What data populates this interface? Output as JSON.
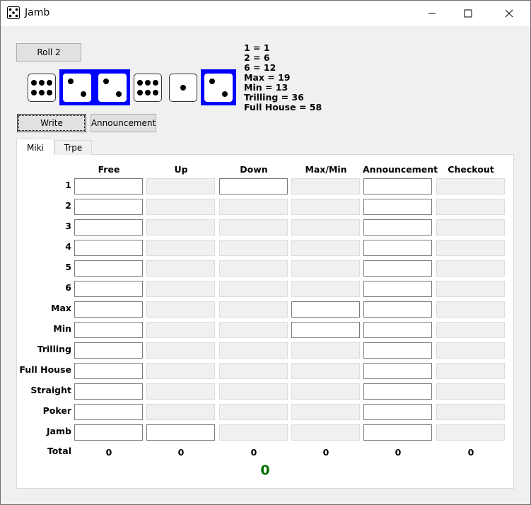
{
  "window": {
    "title": "Jamb"
  },
  "controls": {
    "roll_label": "Roll 2",
    "write_label": "Write",
    "announcement_label": "Announcement"
  },
  "dice": [
    {
      "value": 6,
      "selected": false
    },
    {
      "value": 2,
      "selected": true
    },
    {
      "value": 2,
      "selected": true
    },
    {
      "value": 6,
      "selected": false
    },
    {
      "value": 1,
      "selected": false
    },
    {
      "value": 2,
      "selected": true
    }
  ],
  "info_lines": [
    "1 = 1",
    "2 = 6",
    "6 = 12",
    "Max = 19",
    "Min = 13",
    "Trilling = 36",
    "Full House = 58"
  ],
  "tabs": [
    {
      "label": "Miki",
      "active": true
    },
    {
      "label": "Trpe",
      "active": false
    }
  ],
  "table": {
    "columns": [
      "Free",
      "Up",
      "Down",
      "Max/Min",
      "Announcement",
      "Checkout"
    ],
    "rows": [
      "1",
      "2",
      "3",
      "4",
      "5",
      "6",
      "Max",
      "Min",
      "Trilling",
      "Full House",
      "Straight",
      "Poker",
      "Jamb"
    ],
    "enabled": [
      [
        true,
        false,
        true,
        false,
        true,
        false
      ],
      [
        true,
        false,
        false,
        false,
        true,
        false
      ],
      [
        true,
        false,
        false,
        false,
        true,
        false
      ],
      [
        true,
        false,
        false,
        false,
        true,
        false
      ],
      [
        true,
        false,
        false,
        false,
        true,
        false
      ],
      [
        true,
        false,
        false,
        false,
        true,
        false
      ],
      [
        true,
        false,
        false,
        true,
        true,
        false
      ],
      [
        true,
        false,
        false,
        true,
        true,
        false
      ],
      [
        true,
        false,
        false,
        false,
        true,
        false
      ],
      [
        true,
        false,
        false,
        false,
        true,
        false
      ],
      [
        true,
        false,
        false,
        false,
        true,
        false
      ],
      [
        true,
        false,
        false,
        false,
        true,
        false
      ],
      [
        true,
        true,
        false,
        false,
        true,
        false
      ]
    ],
    "total_label": "Total",
    "totals": [
      "0",
      "0",
      "0",
      "0",
      "0",
      "0"
    ],
    "grand_total": "0",
    "grand_total_color": "#007000"
  },
  "colors": {
    "selected_die": "#0000ff"
  }
}
